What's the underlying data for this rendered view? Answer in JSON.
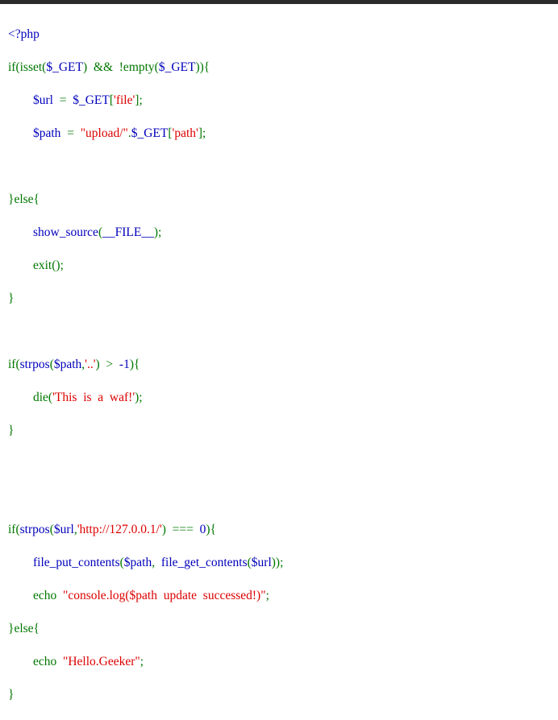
{
  "colors": {
    "default": "#0000bb",
    "keyword": "#007700",
    "string": "#dd0000",
    "top_bar": "#2b2b2b",
    "background": "#ffffff"
  },
  "code": {
    "l1": "<?php",
    "l2a": "if(isset(",
    "l2b": "$_GET",
    "l2c": ")  &&  !empty(",
    "l2d": "$_GET",
    "l2e": ")){",
    "l3a": "        ",
    "l3b": "$url",
    "l3c": "  =  ",
    "l3d": "$_GET",
    "l3e": "[",
    "l3f": "'file'",
    "l3g": "];",
    "l4a": "        ",
    "l4b": "$path",
    "l4c": "  =  ",
    "l4d": "\"upload/\"",
    "l4e": ".",
    "l4f": "$_GET",
    "l4g": "[",
    "l4h": "'path'",
    "l4i": "];",
    "l6": "}else{",
    "l7a": "        ",
    "l7b": "show_source",
    "l7c": "(",
    "l7d": "__FILE__",
    "l7e": ");",
    "l8": "        exit();",
    "l9": "}",
    "l11a": "if(",
    "l11b": "strpos",
    "l11c": "(",
    "l11d": "$path",
    "l11e": ",",
    "l11f": "'..'",
    "l11g": ")  >  ",
    "l11h": "-1",
    "l11i": "){",
    "l12a": "        die(",
    "l12b": "'This  is  a  waf!'",
    "l12c": ");",
    "l13": "}",
    "l16a": "if(",
    "l16b": "strpos",
    "l16c": "(",
    "l16d": "$url",
    "l16e": ",",
    "l16f": "'http://127.0.0.1/'",
    "l16g": ")  ===  ",
    "l16h": "0",
    "l16i": "){",
    "l17a": "        ",
    "l17b": "file_put_contents",
    "l17c": "(",
    "l17d": "$path",
    "l17e": ",  ",
    "l17f": "file_get_contents",
    "l17g": "(",
    "l17h": "$url",
    "l17i": "));",
    "l18a": "        echo  ",
    "l18b": "\"console.log($path  update  successed!)\"",
    "l18c": ";",
    "l19": "}else{",
    "l20a": "        echo  ",
    "l20b": "\"Hello.Geeker\"",
    "l20c": ";",
    "l21": "}"
  }
}
